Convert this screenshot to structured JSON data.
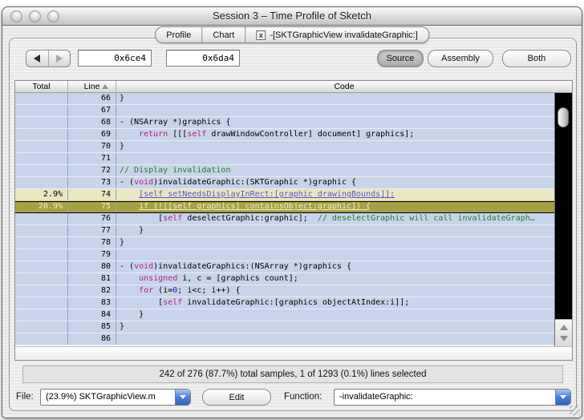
{
  "window": {
    "title": "Session 3 – Time Profile of Sketch"
  },
  "tabs": [
    {
      "label": "Profile"
    },
    {
      "label": "Chart"
    },
    {
      "label": "-[SKTGraphicView invalidateGraphic:]",
      "close_glyph": "x"
    }
  ],
  "toolbar": {
    "address_field_1": "0x6ce4",
    "address_field_2": "0x6da4",
    "view_buttons": [
      {
        "label": "Source",
        "selected": true
      },
      {
        "label": "Assembly",
        "selected": false
      },
      {
        "label": "Both",
        "selected": false
      }
    ]
  },
  "table": {
    "columns": [
      "Total",
      "Line",
      "Code"
    ],
    "rows": [
      {
        "total": "",
        "line": "66",
        "hl": "",
        "code": [
          [
            "p",
            "}"
          ]
        ]
      },
      {
        "total": "",
        "line": "67",
        "hl": "",
        "code": []
      },
      {
        "total": "",
        "line": "68",
        "hl": "",
        "code": [
          [
            "p",
            "- (NSArray *)graphics {"
          ]
        ]
      },
      {
        "total": "",
        "line": "69",
        "hl": "",
        "code": [
          [
            "p",
            "    "
          ],
          [
            "k",
            "return"
          ],
          [
            "p",
            " [[["
          ],
          [
            "k",
            "self"
          ],
          [
            "p",
            " drawWindowController] document] graphics];"
          ]
        ]
      },
      {
        "total": "",
        "line": "70",
        "hl": "",
        "code": [
          [
            "p",
            "}"
          ]
        ]
      },
      {
        "total": "",
        "line": "71",
        "hl": "",
        "code": []
      },
      {
        "total": "",
        "line": "72",
        "hl": "",
        "code": [
          [
            "c",
            "// Display invalidation"
          ]
        ]
      },
      {
        "total": "",
        "line": "73",
        "hl": "",
        "code": [
          [
            "p",
            "- ("
          ],
          [
            "k",
            "void"
          ],
          [
            "p",
            ")invalidateGraphic:(SKTGraphic *)graphic {"
          ]
        ]
      },
      {
        "total": "2.9%",
        "line": "74",
        "hl": "sample",
        "code": [
          [
            "p",
            "    "
          ],
          [
            "l",
            "[self setNeedsDisplayInRect:[graphic drawingBounds]];"
          ]
        ]
      },
      {
        "total": "20.9%",
        "line": "75",
        "hl": "selected",
        "code": [
          [
            "p",
            "    "
          ],
          [
            "s",
            "if (![[self graphics] containsObject:graphic]) {"
          ]
        ]
      },
      {
        "total": "",
        "line": "76",
        "hl": "",
        "code": [
          [
            "p",
            "        ["
          ],
          [
            "k",
            "self"
          ],
          [
            "p",
            " deselectGraphic:graphic];  "
          ],
          [
            "c",
            "// deselectGraphic will call invalidateGraph…"
          ]
        ]
      },
      {
        "total": "",
        "line": "77",
        "hl": "",
        "code": [
          [
            "p",
            "    }"
          ]
        ]
      },
      {
        "total": "",
        "line": "78",
        "hl": "",
        "code": [
          [
            "p",
            "}"
          ]
        ]
      },
      {
        "total": "",
        "line": "79",
        "hl": "",
        "code": []
      },
      {
        "total": "",
        "line": "80",
        "hl": "",
        "code": [
          [
            "p",
            "- ("
          ],
          [
            "k",
            "void"
          ],
          [
            "p",
            ")invalidateGraphics:(NSArray *)graphics {"
          ]
        ]
      },
      {
        "total": "",
        "line": "81",
        "hl": "",
        "code": [
          [
            "p",
            "    "
          ],
          [
            "k",
            "unsigned"
          ],
          [
            "p",
            " i, c = [graphics count];"
          ]
        ]
      },
      {
        "total": "",
        "line": "82",
        "hl": "",
        "code": [
          [
            "p",
            "    "
          ],
          [
            "k",
            "for"
          ],
          [
            "p",
            " (i="
          ],
          [
            "n",
            "0"
          ],
          [
            "p",
            "; i<c; i++) {"
          ]
        ]
      },
      {
        "total": "",
        "line": "83",
        "hl": "",
        "code": [
          [
            "p",
            "        ["
          ],
          [
            "k",
            "self"
          ],
          [
            "p",
            " invalidateGraphic:[graphics objectAtIndex:i]];"
          ]
        ]
      },
      {
        "total": "",
        "line": "84",
        "hl": "",
        "code": [
          [
            "p",
            "    }"
          ]
        ]
      },
      {
        "total": "",
        "line": "85",
        "hl": "",
        "code": [
          [
            "p",
            "}"
          ]
        ]
      },
      {
        "total": "",
        "line": "86",
        "hl": "",
        "code": []
      }
    ]
  },
  "status_bar": {
    "text": "242 of 276 (87.7%) total samples, 1 of 1293 (0.1%) lines selected"
  },
  "footer": {
    "file_label": "File:",
    "file_value": "(23.9%) SKTGraphicView.m",
    "edit_button": "Edit",
    "function_label": "Function:",
    "function_value": "-invalidateGraphic:"
  },
  "colors": {
    "accent_blue_combo": "#4a7ed6",
    "row_bg": "#c8d4ea",
    "row_sep": "#e8edf6",
    "col_sep": "#93a2bd",
    "sample_bg": "#e9e6c3",
    "sel_bg": "#a5a043",
    "sel_text": "#f4f0c8",
    "kw": "#b5217e",
    "comment": "#1e7e2e",
    "num": "#1a1acd",
    "link": "#5a55c8"
  }
}
